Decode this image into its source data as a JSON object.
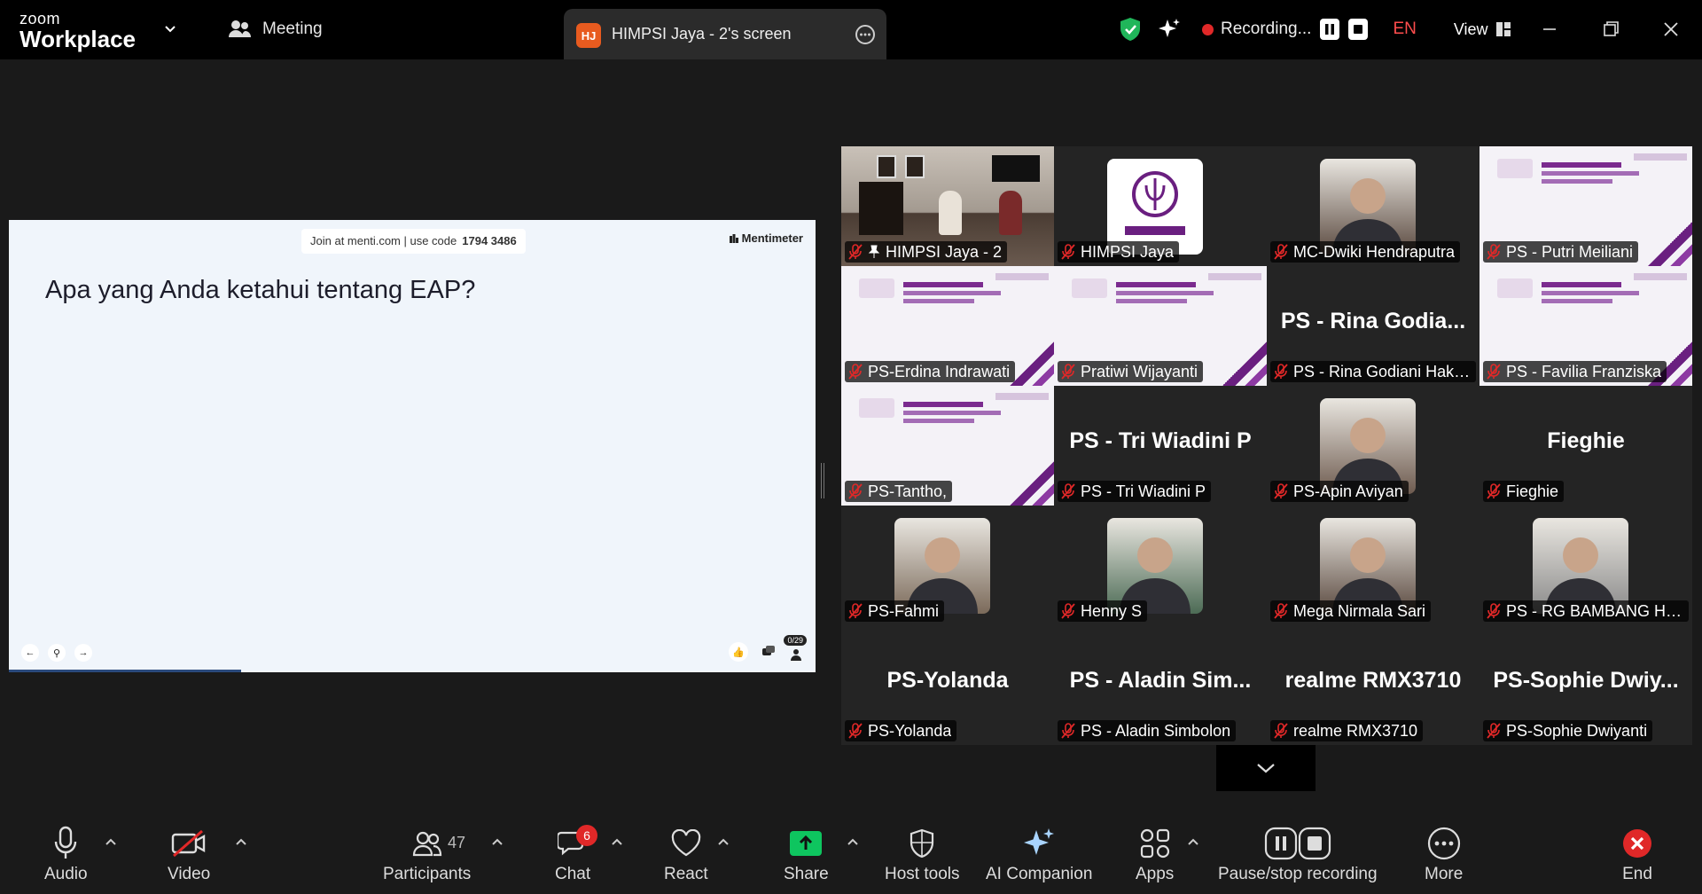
{
  "app": {
    "logo_line1": "zoom",
    "logo_line2": "Workplace",
    "meeting_label": "Meeting",
    "tab_badge": "HJ",
    "tab_title": "HIMPSI Jaya - 2's screen",
    "recording_label": "Recording...",
    "language": "EN",
    "view_label": "View"
  },
  "share": {
    "join_text": "Join at menti.com | use code",
    "join_code": "1794 3486",
    "brand": "Mentimeter",
    "question": "Apa yang Anda ketahui tentang EAP?",
    "counter": "0/29"
  },
  "participants": [
    {
      "label": "HIMPSI Jaya - 2",
      "kind": "video",
      "pinned": true
    },
    {
      "label": "HIMPSI Jaya",
      "kind": "logo"
    },
    {
      "label": "MC-Dwiki Hendraputra",
      "kind": "photo"
    },
    {
      "label": "PS - Putri Meiliani",
      "kind": "slide"
    },
    {
      "label": "PS-Erdina Indrawati",
      "kind": "slide"
    },
    {
      "label": "Pratiwi Wijayanti",
      "kind": "slide"
    },
    {
      "label": "PS - Rina Godiani Haki...",
      "kind": "name",
      "big": "PS - Rina Godia..."
    },
    {
      "label": "PS - Favilia Franziska",
      "kind": "slide"
    },
    {
      "label": "PS-Tantho,",
      "kind": "slide"
    },
    {
      "label": "PS - Tri Wiadini P",
      "kind": "name",
      "big": "PS - Tri Wiadini P"
    },
    {
      "label": "PS-Apin Aviyan",
      "kind": "photo"
    },
    {
      "label": "Fieghie",
      "kind": "name",
      "big": "Fieghie"
    },
    {
      "label": "PS-Fahmi",
      "kind": "photo"
    },
    {
      "label": "Henny S",
      "kind": "photo"
    },
    {
      "label": "Mega Nirmala Sari",
      "kind": "photo"
    },
    {
      "label": "PS - RG BAMBANG HA...",
      "kind": "photo"
    },
    {
      "label": "PS-Yolanda",
      "kind": "name",
      "big": "PS-Yolanda"
    },
    {
      "label": "PS - Aladin Simbolon",
      "kind": "name",
      "big": "PS - Aladin Sim..."
    },
    {
      "label": "realme RMX3710",
      "kind": "name",
      "big": "realme RMX3710"
    },
    {
      "label": "PS-Sophie Dwiyanti",
      "kind": "name",
      "big": "PS-Sophie  Dwiy..."
    }
  ],
  "toolbar": {
    "audio": "Audio",
    "video": "Video",
    "participants": "Participants",
    "participants_count": "47",
    "chat": "Chat",
    "chat_badge": "6",
    "react": "React",
    "share": "Share",
    "host_tools": "Host tools",
    "ai_companion": "AI Companion",
    "apps": "Apps",
    "pause_stop": "Pause/stop recording",
    "more": "More",
    "end": "End"
  },
  "colors": {
    "share_green": "#0ec55f",
    "record_red": "#e02828",
    "active_outline": "#32d583",
    "end_red": "#e02828"
  }
}
